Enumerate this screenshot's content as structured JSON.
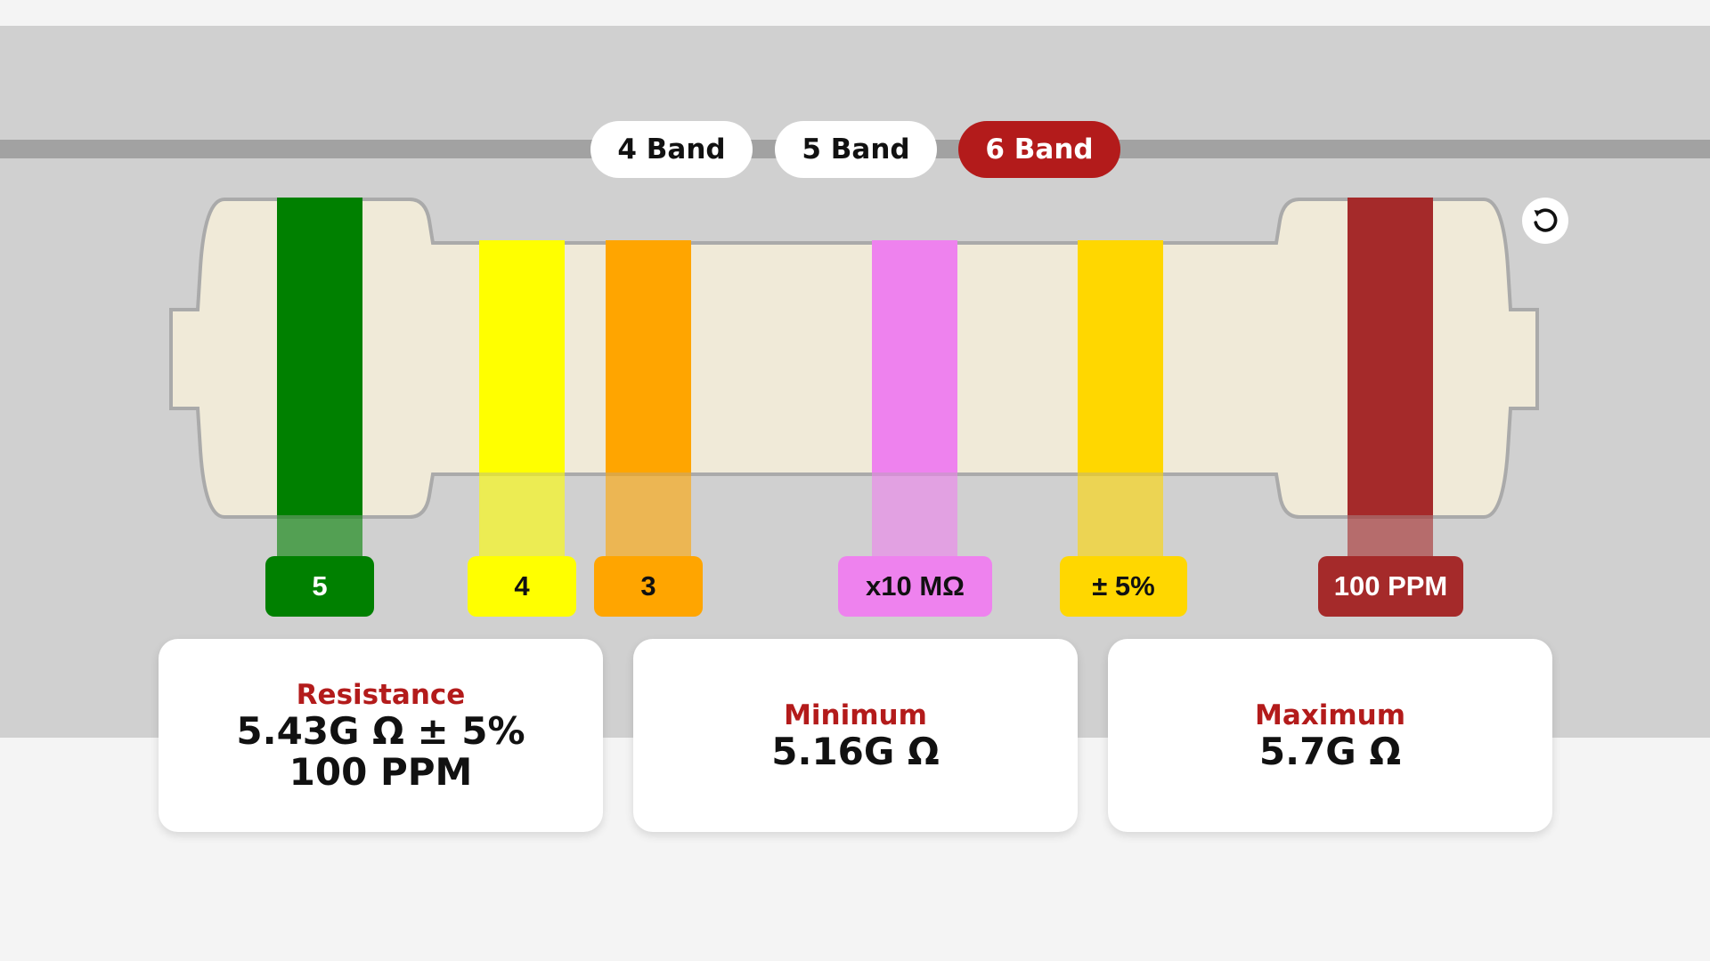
{
  "tabs": [
    {
      "label": "4 Band",
      "active": false
    },
    {
      "label": "5 Band",
      "active": false
    },
    {
      "label": "6 Band",
      "active": true
    }
  ],
  "reset": {
    "icon": "reset-icon"
  },
  "bands": [
    {
      "label": "5",
      "color": "#008000",
      "text_color": "#ffffff"
    },
    {
      "label": "4",
      "color": "#ffff00",
      "text_color": "#111111"
    },
    {
      "label": "3",
      "color": "#ffa500",
      "text_color": "#111111"
    },
    {
      "label": "x10 MΩ",
      "color": "#ee82ee",
      "text_color": "#111111"
    },
    {
      "label": "± 5%",
      "color": "#ffd700",
      "text_color": "#111111"
    },
    {
      "label": "100 PPM",
      "color": "#a52a2a",
      "text_color": "#ffffff"
    }
  ],
  "colors": {
    "accent": "#b31b1b",
    "resistor_body": "#f0ead8",
    "resistor_outline": "#aaaaaa",
    "background_stage": "#d0d0d0",
    "page_background": "#f4f4f4"
  },
  "results": {
    "resistance": {
      "title": "Resistance",
      "value_line1": "5.43G Ω ± 5%",
      "value_line2": "100 PPM"
    },
    "minimum": {
      "title": "Minimum",
      "value": "5.16G Ω"
    },
    "maximum": {
      "title": "Maximum",
      "value": "5.7G Ω"
    }
  }
}
